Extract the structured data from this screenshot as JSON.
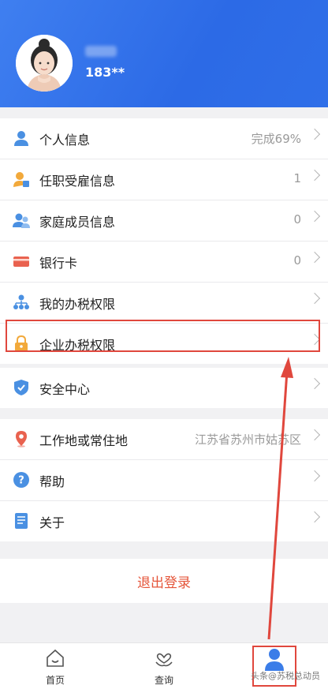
{
  "header": {
    "phone": "183**"
  },
  "menu": {
    "group1": [
      {
        "label": "个人信息",
        "value": "完成69%",
        "icon": "person-icon"
      },
      {
        "label": "任职受雇信息",
        "value": "1",
        "icon": "employment-icon"
      },
      {
        "label": "家庭成员信息",
        "value": "0",
        "icon": "family-icon"
      },
      {
        "label": "银行卡",
        "value": "0",
        "icon": "bank-card-icon"
      },
      {
        "label": "我的办税权限",
        "value": "",
        "icon": "org-chart-icon"
      },
      {
        "label": "企业办税权限",
        "value": "",
        "icon": "lock-icon"
      }
    ],
    "group2": [
      {
        "label": "安全中心",
        "value": "",
        "icon": "shield-icon"
      }
    ],
    "group3": [
      {
        "label": "工作地或常住地",
        "value": "江苏省苏州市姑苏区",
        "icon": "location-pin-icon"
      },
      {
        "label": "帮助",
        "value": "",
        "icon": "help-icon"
      },
      {
        "label": "关于",
        "value": "",
        "icon": "document-icon"
      }
    ]
  },
  "logout_label": "退出登录",
  "tabs": [
    {
      "label": "首页",
      "icon": "home-icon"
    },
    {
      "label": "查询",
      "icon": "heart-hands-icon"
    },
    {
      "label": "",
      "icon": "user-icon"
    }
  ],
  "watermark": "头条@苏税总动员",
  "colors": {
    "header": "#2f6fe8",
    "accent_red": "#e0473d",
    "logout": "#e5553a"
  }
}
